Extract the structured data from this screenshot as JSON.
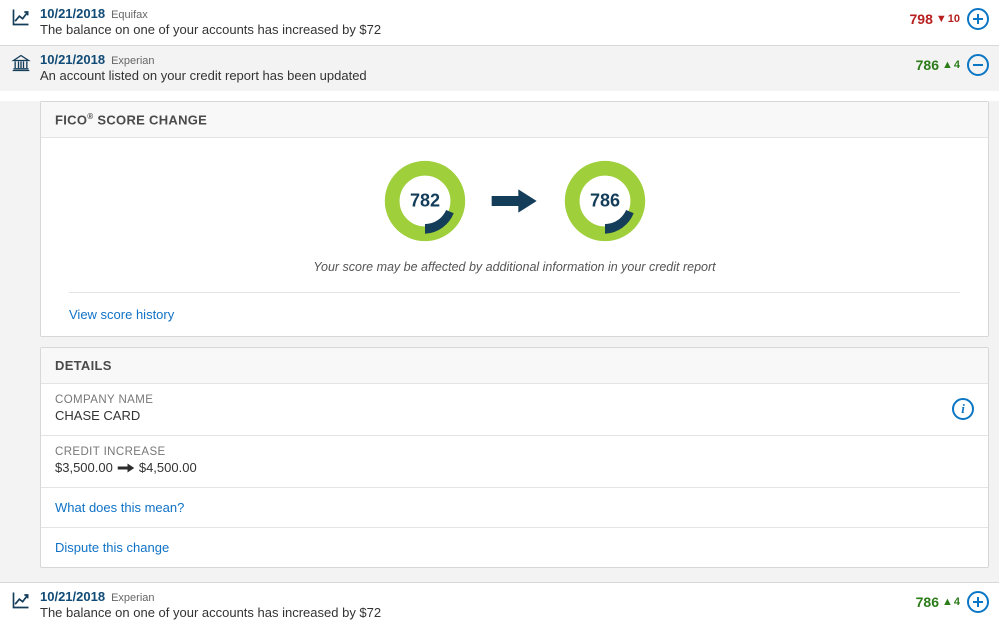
{
  "alerts": [
    {
      "date": "10/21/2018",
      "bureau": "Equifax",
      "desc": "The balance on one of your accounts has increased by $72",
      "score": "798",
      "delta": "10",
      "direction": "down"
    },
    {
      "date": "10/21/2018",
      "bureau": "Experian",
      "desc": "An account listed on your credit report has been updated",
      "score": "786",
      "delta": "4",
      "direction": "up"
    },
    {
      "date": "10/21/2018",
      "bureau": "Experian",
      "desc": "The balance on one of your accounts has increased by $72",
      "score": "786",
      "delta": "4",
      "direction": "up"
    }
  ],
  "score_change": {
    "title_prefix": "FICO",
    "title_suffix": " SCORE CHANGE",
    "from": "782",
    "to": "786",
    "note": "Your score may be affected by additional information in your credit report",
    "history_link": "View score history"
  },
  "details": {
    "title": "DETAILS",
    "company_label": "COMPANY NAME",
    "company_value": "CHASE CARD",
    "credit_label": "CREDIT INCREASE",
    "credit_from": "$3,500.00",
    "credit_to": "$4,500.00",
    "mean_link": "What does this mean?",
    "dispute_link": "Dispute this change"
  },
  "colors": {
    "accent": "#0b76c4",
    "gauge_green": "#9fcf3a",
    "gauge_navy": "#143d5a"
  }
}
